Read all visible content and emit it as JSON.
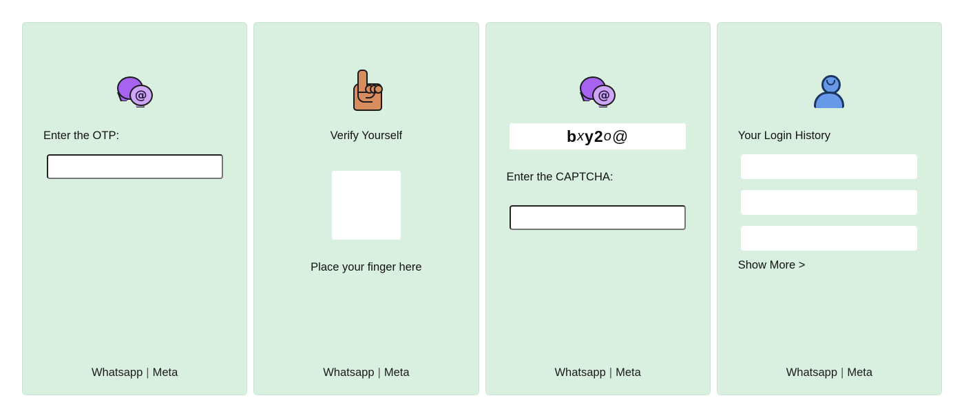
{
  "page": {
    "background_color": "#ffffff",
    "card_background_color": "#d9f0e1",
    "card_border_color": "#c7e6d2",
    "field_color": "#ffffff",
    "text_color": "#111111"
  },
  "footer": {
    "brand_primary": "Whatsapp",
    "separator": "|",
    "brand_secondary": "Meta"
  },
  "cards": [
    {
      "id": "otp-card",
      "icon": "speech-bubbles-at-icon",
      "icon_glyph": "@",
      "label": "Enter the OTP:",
      "input_value": "",
      "input_placeholder": ""
    },
    {
      "id": "verify-card",
      "icon": "index-pointing-up-hand-icon",
      "label": "Verify Yourself",
      "fingerprint_label": "Place your finger here"
    },
    {
      "id": "captcha-card",
      "icon": "speech-bubbles-at-icon",
      "icon_glyph": "@",
      "captcha": {
        "full_text": "b x y 2 o @",
        "characters": [
          {
            "char": "b",
            "style": "bold"
          },
          {
            "char": "x",
            "style": "italic"
          },
          {
            "char": "y",
            "style": "bold"
          },
          {
            "char": "2",
            "style": "bold"
          },
          {
            "char": "o",
            "style": "italic"
          },
          {
            "char": "@",
            "style": "normal"
          }
        ]
      },
      "label": "Enter the CAPTCHA:",
      "input_value": "",
      "input_placeholder": ""
    },
    {
      "id": "login-history-card",
      "icon": "person-bust-icon",
      "label": "Your Login History",
      "rows": [
        "",
        "",
        ""
      ],
      "show_more_label": "Show More >"
    }
  ]
}
